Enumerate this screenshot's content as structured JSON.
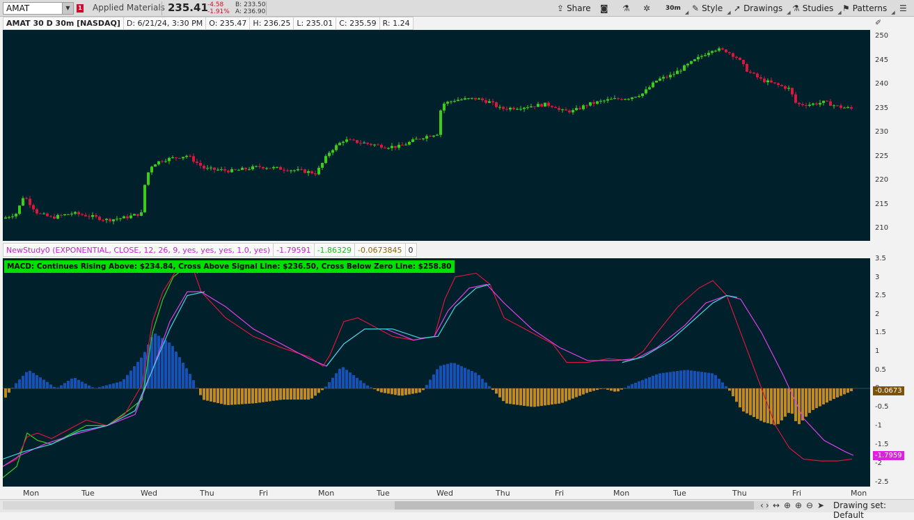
{
  "toolbar": {
    "symbol": "AMAT",
    "company": "Applied Materials",
    "last_price": "235.41",
    "change": "-4.58",
    "change_pct": "-1.91%",
    "bid": "B: 233.50",
    "ask": "A: 236.90",
    "share_label": "Share",
    "timeframe_label": "30m",
    "style_label": "Style",
    "drawings_label": "Drawings",
    "studies_label": "Studies",
    "patterns_label": "Patterns"
  },
  "info_bar": {
    "title": "AMAT 30 D 30m [NASDAQ]",
    "date": "D: 6/21/24, 3:30 PM",
    "open": "O: 235.47",
    "high": "H: 236.25",
    "low": "L: 235.01",
    "close": "C: 235.59",
    "range": "R: 1.24"
  },
  "study_bar": {
    "name": "NewStudy0 (EXPONENTIAL, CLOSE, 12, 26, 9, yes, yes, yes, 1.0, yes)",
    "value1": "-1.79591",
    "value2": "-1.86329",
    "value3": "-0.0673845",
    "value4": "0"
  },
  "macd_banner": "MACD: Continues Rising Above: $234.84, Cross Above Signal Line: $236.50, Cross Below Zero Line: $258.80",
  "price_axis_ticks": [
    "250",
    "245",
    "240",
    "235",
    "230",
    "225",
    "220",
    "215",
    "210"
  ],
  "macd_axis_ticks": [
    "3.5",
    "3",
    "2.5",
    "2",
    "1.5",
    "1",
    "0.5",
    "0",
    "-0.5",
    "-1",
    "-1.5",
    "-2",
    "-2.5"
  ],
  "x_labels": [
    "Mon",
    "Tue",
    "Wed",
    "Thu",
    "Fri",
    "Mon",
    "Tue",
    "Wed",
    "Thu",
    "Fri",
    "Mon",
    "Tue",
    "Thu",
    "Fri",
    "Mon"
  ],
  "price_tags": {
    "hist": "-0.0673",
    "macd": "-1.7959"
  },
  "drawing_set": "Drawing set: Default",
  "colors": {
    "background": "#00202c",
    "up_candle": "#3ccc1c",
    "down_candle": "#d8183c",
    "macd_line": "#3ccc1c",
    "signal_line": "#d8183c",
    "avg_line": "#e040e8",
    "avg_line2": "#40d8e0",
    "hist_pos": "#1452b8",
    "hist_neg": "#c08a20",
    "banner": "#00e000"
  },
  "chart_data": {
    "type": "candlestick",
    "series": [
      {
        "name": "AMAT",
        "values": []
      }
    ]
  }
}
